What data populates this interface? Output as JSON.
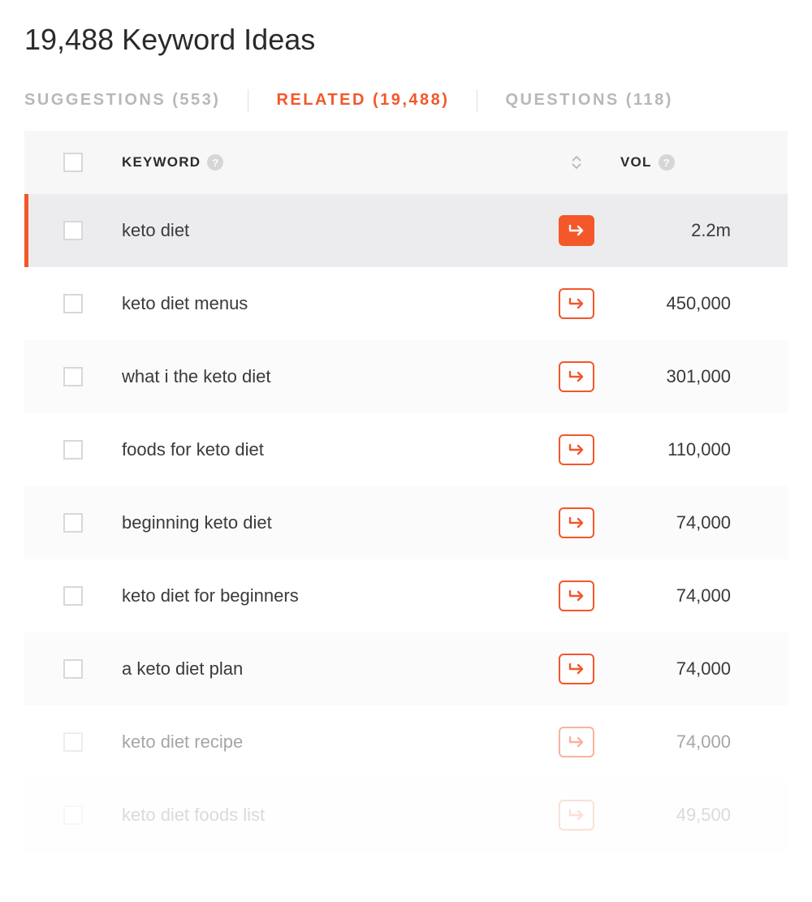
{
  "page": {
    "title": "19,488 Keyword Ideas"
  },
  "tabs": {
    "suggestions": "SUGGESTIONS (553)",
    "related": "RELATED (19,488)",
    "questions": "QUESTIONS (118)"
  },
  "columns": {
    "keyword": "KEYWORD",
    "vol": "VOL"
  },
  "rows": [
    {
      "keyword": "keto diet",
      "vol": "2.2m",
      "selected": true,
      "filled": true
    },
    {
      "keyword": "keto diet menus",
      "vol": "450,000"
    },
    {
      "keyword": "what i the keto diet",
      "vol": "301,000"
    },
    {
      "keyword": "foods for keto diet",
      "vol": "110,000"
    },
    {
      "keyword": "beginning keto diet",
      "vol": "74,000"
    },
    {
      "keyword": "keto diet for beginners",
      "vol": "74,000"
    },
    {
      "keyword": "a keto diet plan",
      "vol": "74,000"
    },
    {
      "keyword": "keto diet recipe",
      "vol": "74,000",
      "faded": true
    },
    {
      "keyword": "keto diet foods list",
      "vol": "49,500",
      "faded2": true
    }
  ]
}
